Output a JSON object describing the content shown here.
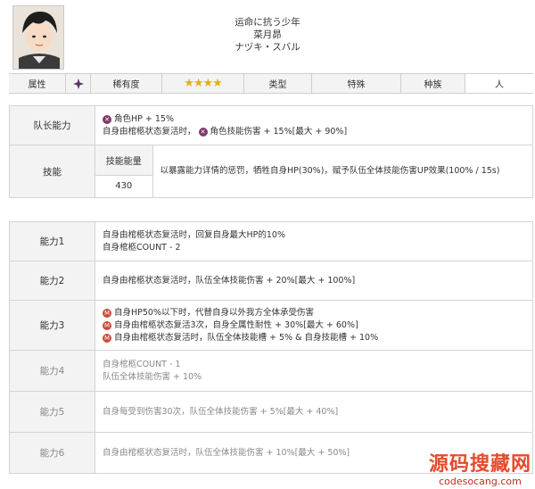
{
  "header": {
    "subtitle": "运命に抗う少年",
    "name": "菜月昴",
    "kana": "ナヅキ・スバル"
  },
  "info": {
    "attr_label": "属性",
    "rarity_label": "稀有度",
    "stars": "★★★★",
    "type_label": "类型",
    "type_value": "特殊",
    "race_label": "种族",
    "race_value": "人"
  },
  "leader": {
    "label": "队长能力",
    "line1_text": "角色HP + 15%",
    "line2_a": "自身由棺柩状态复活时，",
    "line2_b": "角色技能伤害 + 15%[最大 + 90%]"
  },
  "skill": {
    "label": "技能",
    "energy_label": "技能能量",
    "energy_value": "430",
    "desc": "以暴露能力详情的惩罚，牺牲自身HP(30%)，赋予队伍全体技能伤害UP效果(100% / 15s)"
  },
  "abilities": [
    {
      "label": "能力1",
      "lines": [
        "自身由棺柩状态复活时，回复自身最大HP的10%",
        "自身棺柩COUNT - 2"
      ]
    },
    {
      "label": "能力2",
      "lines": [
        "自身由棺柩状态复活时，队伍全体技能伤害 + 20%[最大 + 100%]"
      ]
    },
    {
      "label": "能力3",
      "lines": [
        "自身HP50%以下时，代替自身以外我方全体承受伤害",
        "自身由棺柩状态复活3次，自身全属性耐性 + 30%[最大 + 60%]",
        "自身由棺柩状态复活时，队伍全体技能槽 + 5% & 自身技能槽 + 10%"
      ]
    },
    {
      "label": "能力4",
      "lines": [
        "自身棺柩COUNT - 1",
        "队伍全体技能伤害 + 10%"
      ]
    },
    {
      "label": "能力5",
      "lines": [
        "自身每受到伤害30次，队伍全体技能伤害 + 5%[最大 + 40%]"
      ]
    },
    {
      "label": "能力6",
      "lines": [
        "自身由棺柩状态复活时，队伍全体技能伤害 + 10%[最大 + 50%]"
      ]
    }
  ],
  "watermark": {
    "cn": "源码搜藏网",
    "en": "codesocang.com"
  },
  "colors": {
    "accent": "#7d3b6a",
    "star": "#e3b018",
    "watermark": "#e74a2a"
  }
}
